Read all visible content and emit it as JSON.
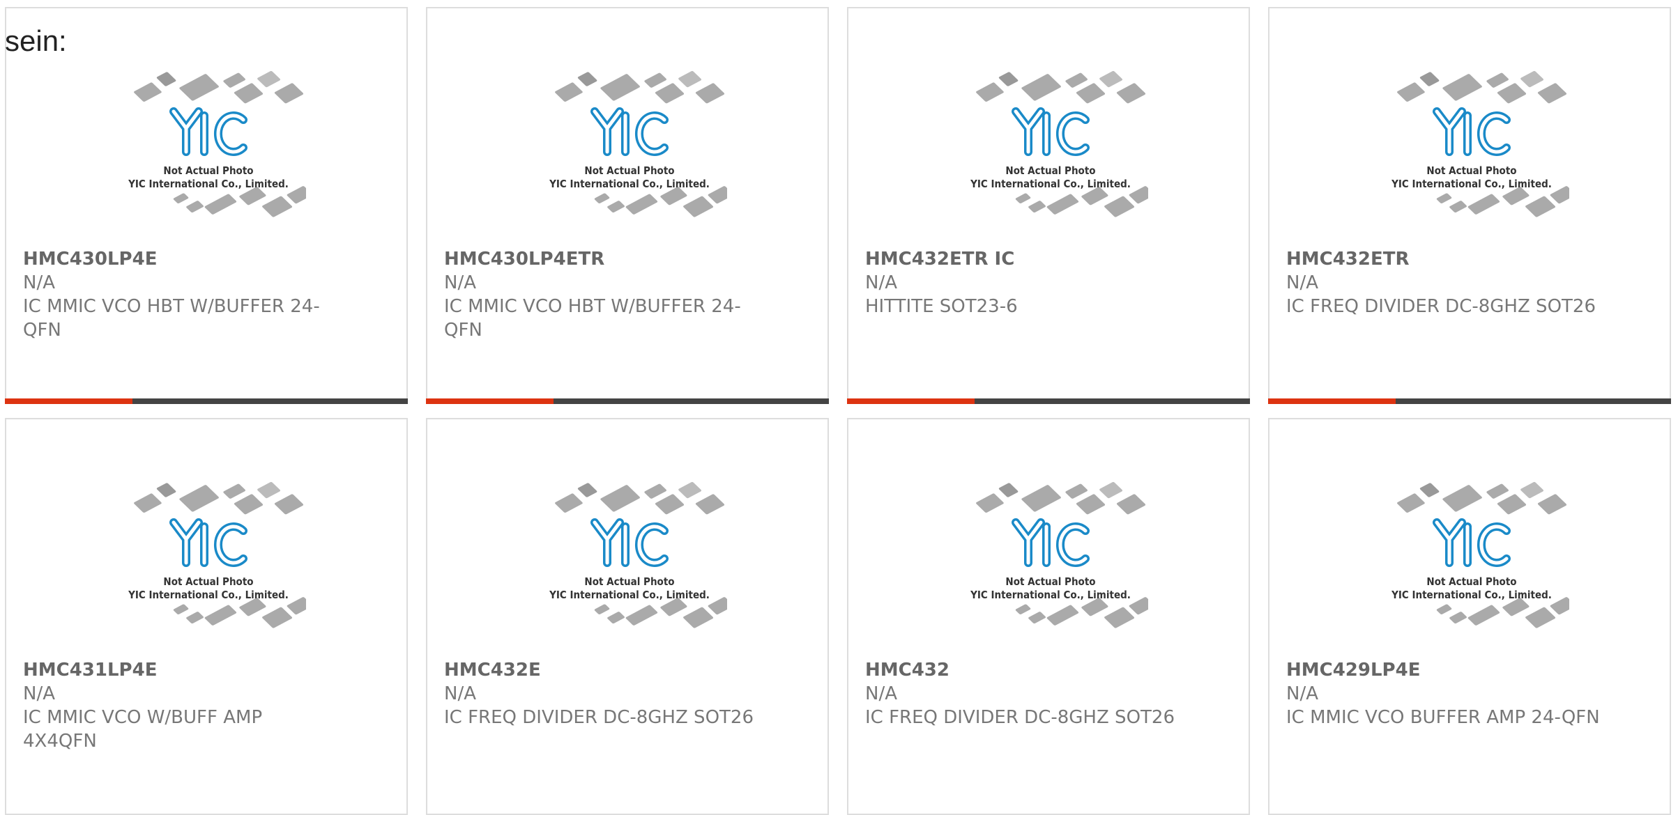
{
  "intro_text": "sein:",
  "placeholder": {
    "brand": "YIC",
    "line1": "Not Actual Photo",
    "line2": "YIC International Co., Limited."
  },
  "colors": {
    "accent": "#dd3311",
    "bar": "#444444",
    "border": "#dddddd",
    "logo_blue": "#1a8ac8",
    "chip_gray": "#aaaaaa"
  },
  "products": [
    {
      "name": "HMC430LP4E",
      "mfr": "N/A",
      "desc": "IC MMIC VCO HBT W/BUFFER 24-QFN"
    },
    {
      "name": "HMC430LP4ETR",
      "mfr": "N/A",
      "desc": "IC MMIC VCO HBT W/BUFFER 24-QFN"
    },
    {
      "name": "HMC432ETR IC",
      "mfr": "N/A",
      "desc": "HITTITE SOT23-6"
    },
    {
      "name": "HMC432ETR",
      "mfr": "N/A",
      "desc": "IC FREQ DIVIDER DC-8GHZ SOT26"
    },
    {
      "name": "HMC431LP4E",
      "mfr": "N/A",
      "desc": "IC MMIC VCO W/BUFF AMP 4X4QFN"
    },
    {
      "name": "HMC432E",
      "mfr": "N/A",
      "desc": "IC FREQ DIVIDER DC-8GHZ SOT26"
    },
    {
      "name": "HMC432",
      "mfr": "N/A",
      "desc": "IC FREQ DIVIDER DC-8GHZ SOT26"
    },
    {
      "name": "HMC429LP4E",
      "mfr": "N/A",
      "desc": "IC MMIC VCO BUFFER AMP 24-QFN"
    }
  ]
}
